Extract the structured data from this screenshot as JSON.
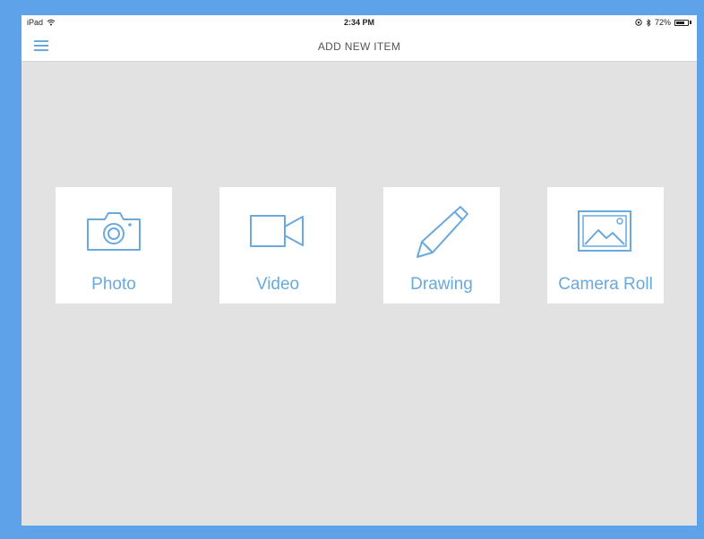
{
  "status_bar": {
    "device": "iPad",
    "time": "2:34 PM",
    "battery": "72%",
    "battery_level": 0.72
  },
  "nav": {
    "title": "ADD NEW ITEM",
    "menu_icon": "hamburger-menu-icon"
  },
  "options": [
    {
      "label": "Photo",
      "icon": "camera-icon"
    },
    {
      "label": "Video",
      "icon": "video-camera-icon"
    },
    {
      "label": "Drawing",
      "icon": "pencil-icon"
    },
    {
      "label": "Camera Roll",
      "icon": "image-gallery-icon"
    }
  ],
  "colors": {
    "frame": "#5ea2ea",
    "background": "#e2e2e2",
    "accent": "#6aa9de"
  }
}
